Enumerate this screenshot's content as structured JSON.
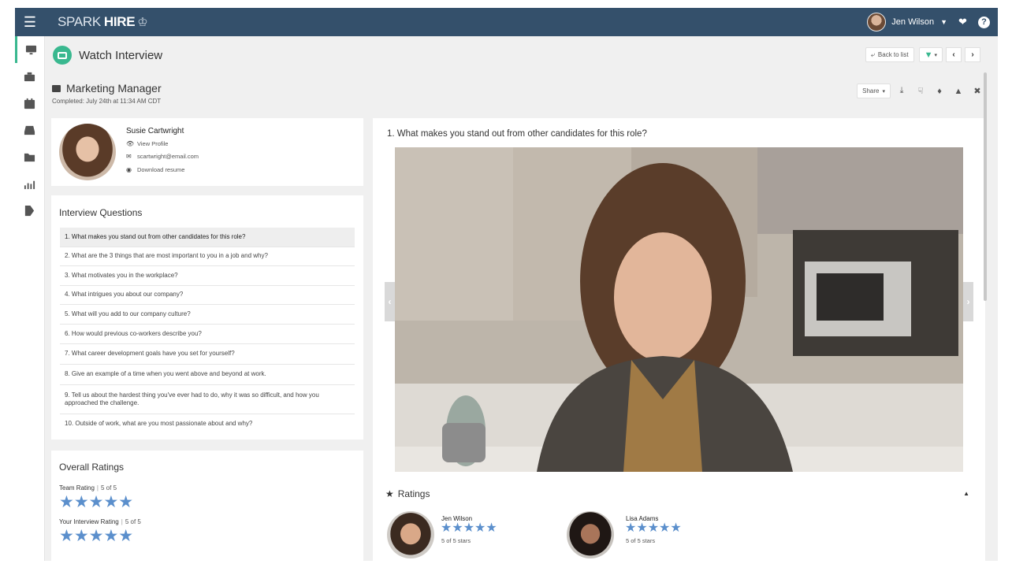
{
  "app": {
    "logo_spark": "SPARK",
    "logo_hire": "HIRE",
    "user_name": "Jen Wilson"
  },
  "page": {
    "title": "Watch Interview",
    "back_label": "Back to list"
  },
  "job": {
    "title": "Marketing Manager",
    "completed": "Completed: July 24th at 11:34 AM CDT",
    "share_label": "Share"
  },
  "candidate": {
    "name": "Susie Cartwright",
    "view_profile": "View Profile",
    "email": "scartwright@email.com",
    "download_resume": "Download resume"
  },
  "questions": {
    "title": "Interview Questions",
    "items": [
      "1. What makes you stand out from other candidates for this role?",
      "2. What are the 3 things that are most important to you in a job and why?",
      "3. What motivates you in the workplace?",
      "4. What intrigues you about our company?",
      "5. What will you add to our company culture?",
      "6. How would previous co-workers describe you?",
      "7. What career development goals have you set for yourself?",
      "8. Give an example of a time when you went above and beyond at work.",
      "9. Tell us about the hardest thing you've ever had to do, why it was so difficult, and how you approached the challenge.",
      "10. Outside of work, what are you most passionate about and why?"
    ],
    "active_index": 0
  },
  "overall_ratings": {
    "title": "Overall Ratings",
    "team_label": "Team Rating",
    "team_score": "5 of 5",
    "team_stars": 5,
    "your_label": "Your Interview Rating",
    "your_score": "5 of 5",
    "your_stars": 5
  },
  "video": {
    "question": "1. What makes you stand out from other candidates for this role?"
  },
  "ratings": {
    "title": "Ratings",
    "raters": [
      {
        "name": "Jen Wilson",
        "score": "5 of 5 stars",
        "stars": 5
      },
      {
        "name": "Lisa Adams",
        "score": "5 of 5 stars",
        "stars": 5
      }
    ]
  },
  "colors": {
    "topbar": "#34506b",
    "accent": "#39b88f",
    "star": "#5b8fcc"
  }
}
